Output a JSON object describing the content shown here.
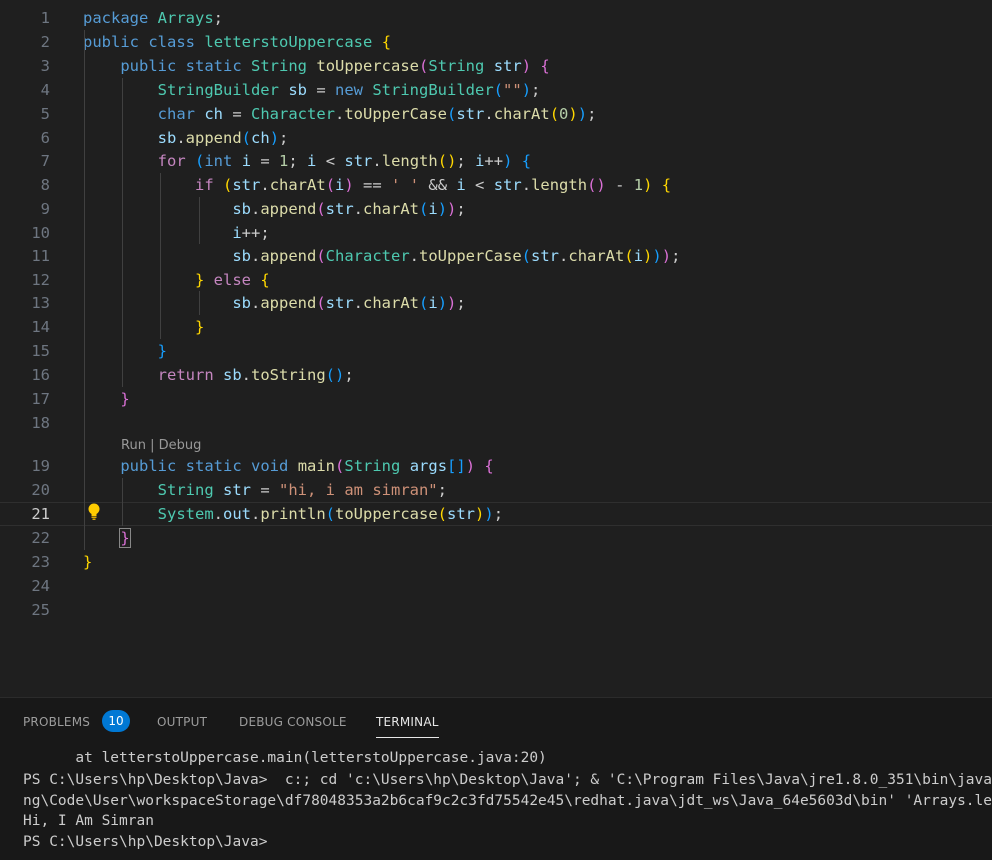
{
  "editor": {
    "lines": [
      {
        "n": "1",
        "tokens": [
          [
            "kw",
            "package"
          ],
          [
            "pl",
            " "
          ],
          [
            "ty",
            "Arrays"
          ],
          [
            "pl",
            ";"
          ]
        ]
      },
      {
        "n": "2",
        "tokens": [
          [
            "kw",
            "public"
          ],
          [
            "pl",
            " "
          ],
          [
            "kw",
            "class"
          ],
          [
            "pl",
            " "
          ],
          [
            "ty",
            "letterstoUppercase"
          ],
          [
            "pl",
            " "
          ],
          [
            "b1",
            "{"
          ]
        ]
      },
      {
        "n": "3",
        "tokens": [
          [
            "pl",
            "    "
          ],
          [
            "kw",
            "public"
          ],
          [
            "pl",
            " "
          ],
          [
            "kw",
            "static"
          ],
          [
            "pl",
            " "
          ],
          [
            "ty",
            "String"
          ],
          [
            "pl",
            " "
          ],
          [
            "fn",
            "toUppercase"
          ],
          [
            "b2",
            "("
          ],
          [
            "ty",
            "String"
          ],
          [
            "pl",
            " "
          ],
          [
            "vr",
            "str"
          ],
          [
            "b2",
            ")"
          ],
          [
            "pl",
            " "
          ],
          [
            "b2",
            "{"
          ]
        ]
      },
      {
        "n": "4",
        "tokens": [
          [
            "pl",
            "        "
          ],
          [
            "ty",
            "StringBuilder"
          ],
          [
            "pl",
            " "
          ],
          [
            "vr",
            "sb"
          ],
          [
            "pl",
            " = "
          ],
          [
            "kw",
            "new"
          ],
          [
            "pl",
            " "
          ],
          [
            "ty",
            "StringBuilder"
          ],
          [
            "b3",
            "("
          ],
          [
            "st",
            "\"\""
          ],
          [
            "b3",
            ")"
          ],
          [
            "pl",
            ";"
          ]
        ]
      },
      {
        "n": "5",
        "tokens": [
          [
            "pl",
            "        "
          ],
          [
            "kw",
            "char"
          ],
          [
            "pl",
            " "
          ],
          [
            "vr",
            "ch"
          ],
          [
            "pl",
            " = "
          ],
          [
            "ty",
            "Character"
          ],
          [
            "pl",
            "."
          ],
          [
            "fn",
            "toUpperCase"
          ],
          [
            "b3",
            "("
          ],
          [
            "vr",
            "str"
          ],
          [
            "pl",
            "."
          ],
          [
            "fn",
            "charAt"
          ],
          [
            "b1",
            "("
          ],
          [
            "nm",
            "0"
          ],
          [
            "b1",
            ")"
          ],
          [
            "b3",
            ")"
          ],
          [
            "pl",
            ";"
          ]
        ]
      },
      {
        "n": "6",
        "tokens": [
          [
            "pl",
            "        "
          ],
          [
            "vr",
            "sb"
          ],
          [
            "pl",
            "."
          ],
          [
            "fn",
            "append"
          ],
          [
            "b3",
            "("
          ],
          [
            "vr",
            "ch"
          ],
          [
            "b3",
            ")"
          ],
          [
            "pl",
            ";"
          ]
        ]
      },
      {
        "n": "7",
        "tokens": [
          [
            "pl",
            "        "
          ],
          [
            "ctl",
            "for"
          ],
          [
            "pl",
            " "
          ],
          [
            "b3",
            "("
          ],
          [
            "kw",
            "int"
          ],
          [
            "pl",
            " "
          ],
          [
            "vr",
            "i"
          ],
          [
            "pl",
            " = "
          ],
          [
            "nm",
            "1"
          ],
          [
            "pl",
            "; "
          ],
          [
            "vr",
            "i"
          ],
          [
            "pl",
            " < "
          ],
          [
            "vr",
            "str"
          ],
          [
            "pl",
            "."
          ],
          [
            "fn",
            "length"
          ],
          [
            "b1",
            "()"
          ],
          [
            "pl",
            "; "
          ],
          [
            "vr",
            "i"
          ],
          [
            "pl",
            "++"
          ],
          [
            "b3",
            ")"
          ],
          [
            "pl",
            " "
          ],
          [
            "b3",
            "{"
          ]
        ]
      },
      {
        "n": "8",
        "tokens": [
          [
            "pl",
            "            "
          ],
          [
            "ctl",
            "if"
          ],
          [
            "pl",
            " "
          ],
          [
            "b1",
            "("
          ],
          [
            "vr",
            "str"
          ],
          [
            "pl",
            "."
          ],
          [
            "fn",
            "charAt"
          ],
          [
            "b2",
            "("
          ],
          [
            "vr",
            "i"
          ],
          [
            "b2",
            ")"
          ],
          [
            "pl",
            " == "
          ],
          [
            "st",
            "' '"
          ],
          [
            "pl",
            " && "
          ],
          [
            "vr",
            "i"
          ],
          [
            "pl",
            " < "
          ],
          [
            "vr",
            "str"
          ],
          [
            "pl",
            "."
          ],
          [
            "fn",
            "length"
          ],
          [
            "b2",
            "()"
          ],
          [
            "pl",
            " - "
          ],
          [
            "nm",
            "1"
          ],
          [
            "b1",
            ")"
          ],
          [
            "pl",
            " "
          ],
          [
            "b1",
            "{"
          ]
        ]
      },
      {
        "n": "9",
        "tokens": [
          [
            "pl",
            "                "
          ],
          [
            "vr",
            "sb"
          ],
          [
            "pl",
            "."
          ],
          [
            "fn",
            "append"
          ],
          [
            "b2",
            "("
          ],
          [
            "vr",
            "str"
          ],
          [
            "pl",
            "."
          ],
          [
            "fn",
            "charAt"
          ],
          [
            "b3",
            "("
          ],
          [
            "vr",
            "i"
          ],
          [
            "b3",
            ")"
          ],
          [
            "b2",
            ")"
          ],
          [
            "pl",
            ";"
          ]
        ]
      },
      {
        "n": "10",
        "tokens": [
          [
            "pl",
            "                "
          ],
          [
            "vr",
            "i"
          ],
          [
            "pl",
            "++;"
          ]
        ]
      },
      {
        "n": "11",
        "tokens": [
          [
            "pl",
            "                "
          ],
          [
            "vr",
            "sb"
          ],
          [
            "pl",
            "."
          ],
          [
            "fn",
            "append"
          ],
          [
            "b2",
            "("
          ],
          [
            "ty",
            "Character"
          ],
          [
            "pl",
            "."
          ],
          [
            "fn",
            "toUpperCase"
          ],
          [
            "b3",
            "("
          ],
          [
            "vr",
            "str"
          ],
          [
            "pl",
            "."
          ],
          [
            "fn",
            "charAt"
          ],
          [
            "b1",
            "("
          ],
          [
            "vr",
            "i"
          ],
          [
            "b1",
            ")"
          ],
          [
            "b3",
            ")"
          ],
          [
            "b2",
            ")"
          ],
          [
            "pl",
            ";"
          ]
        ]
      },
      {
        "n": "12",
        "tokens": [
          [
            "pl",
            "            "
          ],
          [
            "b1",
            "}"
          ],
          [
            "pl",
            " "
          ],
          [
            "ctl",
            "else"
          ],
          [
            "pl",
            " "
          ],
          [
            "b1",
            "{"
          ]
        ]
      },
      {
        "n": "13",
        "tokens": [
          [
            "pl",
            "                "
          ],
          [
            "vr",
            "sb"
          ],
          [
            "pl",
            "."
          ],
          [
            "fn",
            "append"
          ],
          [
            "b2",
            "("
          ],
          [
            "vr",
            "str"
          ],
          [
            "pl",
            "."
          ],
          [
            "fn",
            "charAt"
          ],
          [
            "b3",
            "("
          ],
          [
            "vr",
            "i"
          ],
          [
            "b3",
            ")"
          ],
          [
            "b2",
            ")"
          ],
          [
            "pl",
            ";"
          ]
        ]
      },
      {
        "n": "14",
        "tokens": [
          [
            "pl",
            "            "
          ],
          [
            "b1",
            "}"
          ]
        ]
      },
      {
        "n": "15",
        "tokens": [
          [
            "pl",
            "        "
          ],
          [
            "b3",
            "}"
          ]
        ]
      },
      {
        "n": "16",
        "tokens": [
          [
            "pl",
            "        "
          ],
          [
            "ctl",
            "return"
          ],
          [
            "pl",
            " "
          ],
          [
            "vr",
            "sb"
          ],
          [
            "pl",
            "."
          ],
          [
            "fn",
            "toString"
          ],
          [
            "b3",
            "()"
          ],
          [
            "pl",
            ";"
          ]
        ]
      },
      {
        "n": "17",
        "tokens": [
          [
            "pl",
            "    "
          ],
          [
            "b2",
            "}"
          ]
        ]
      },
      {
        "n": "18",
        "tokens": []
      },
      {
        "n": "19",
        "tokens": [
          [
            "pl",
            "    "
          ],
          [
            "kw",
            "public"
          ],
          [
            "pl",
            " "
          ],
          [
            "kw",
            "static"
          ],
          [
            "pl",
            " "
          ],
          [
            "kw",
            "void"
          ],
          [
            "pl",
            " "
          ],
          [
            "fn",
            "main"
          ],
          [
            "b2",
            "("
          ],
          [
            "ty",
            "String"
          ],
          [
            "pl",
            " "
          ],
          [
            "vr",
            "args"
          ],
          [
            "b3",
            "[]"
          ],
          [
            "b2",
            ")"
          ],
          [
            "pl",
            " "
          ],
          [
            "b2",
            "{"
          ]
        ]
      },
      {
        "n": "20",
        "tokens": [
          [
            "pl",
            "        "
          ],
          [
            "ty",
            "String"
          ],
          [
            "pl",
            " "
          ],
          [
            "vr",
            "str"
          ],
          [
            "pl",
            " = "
          ],
          [
            "st",
            "\"hi, i am simran\""
          ],
          [
            "pl",
            ";"
          ]
        ]
      },
      {
        "n": "21",
        "tokens": [
          [
            "pl",
            "        "
          ],
          [
            "ty",
            "System"
          ],
          [
            "pl",
            "."
          ],
          [
            "vr",
            "out"
          ],
          [
            "pl",
            "."
          ],
          [
            "fn",
            "println"
          ],
          [
            "b3",
            "("
          ],
          [
            "fn",
            "toUppercase"
          ],
          [
            "b1",
            "("
          ],
          [
            "vr",
            "str"
          ],
          [
            "b1",
            ")"
          ],
          [
            "b3",
            ")"
          ],
          [
            "pl",
            ";"
          ]
        ]
      },
      {
        "n": "22",
        "tokens": [
          [
            "pl",
            "    "
          ],
          [
            "b2",
            "}"
          ]
        ]
      },
      {
        "n": "23",
        "tokens": [
          [
            "b1",
            "}"
          ]
        ]
      },
      {
        "n": "24",
        "tokens": []
      },
      {
        "n": "25",
        "tokens": []
      }
    ],
    "codelens": {
      "run": "Run",
      "sep": " | ",
      "debug": "Debug"
    }
  },
  "panel": {
    "tabs": {
      "problems": "PROBLEMS",
      "problems_count": "10",
      "output": "OUTPUT",
      "debug_console": "DEBUG CONSOLE",
      "terminal": "TERMINAL"
    },
    "terminal_lines": [
      "      at letterstoUppercase.main(letterstoUppercase.java:20)",
      "PS C:\\Users\\hp\\Desktop\\Java>  c:; cd 'c:\\Users\\hp\\Desktop\\Java'; & 'C:\\Program Files\\Java\\jre1.8.0_351\\bin\\java.exe'",
      "ng\\Code\\User\\workspaceStorage\\df78048353a2b6caf9c2c3fd75542e45\\redhat.java\\jdt_ws\\Java_64e5603d\\bin' 'Arrays.letterstoUppercase'",
      "Hi, I Am Simran",
      "PS C:\\Users\\hp\\Desktop\\Java>"
    ]
  },
  "colors": {
    "editor_bg": "#1f1f1f",
    "keyword": "#569cd6",
    "control": "#c586c0",
    "type": "#4ec9b0",
    "function": "#dcdcaa",
    "variable": "#9cdcfe",
    "string": "#ce9178",
    "number": "#b5cea8",
    "badge": "#0078d4"
  }
}
